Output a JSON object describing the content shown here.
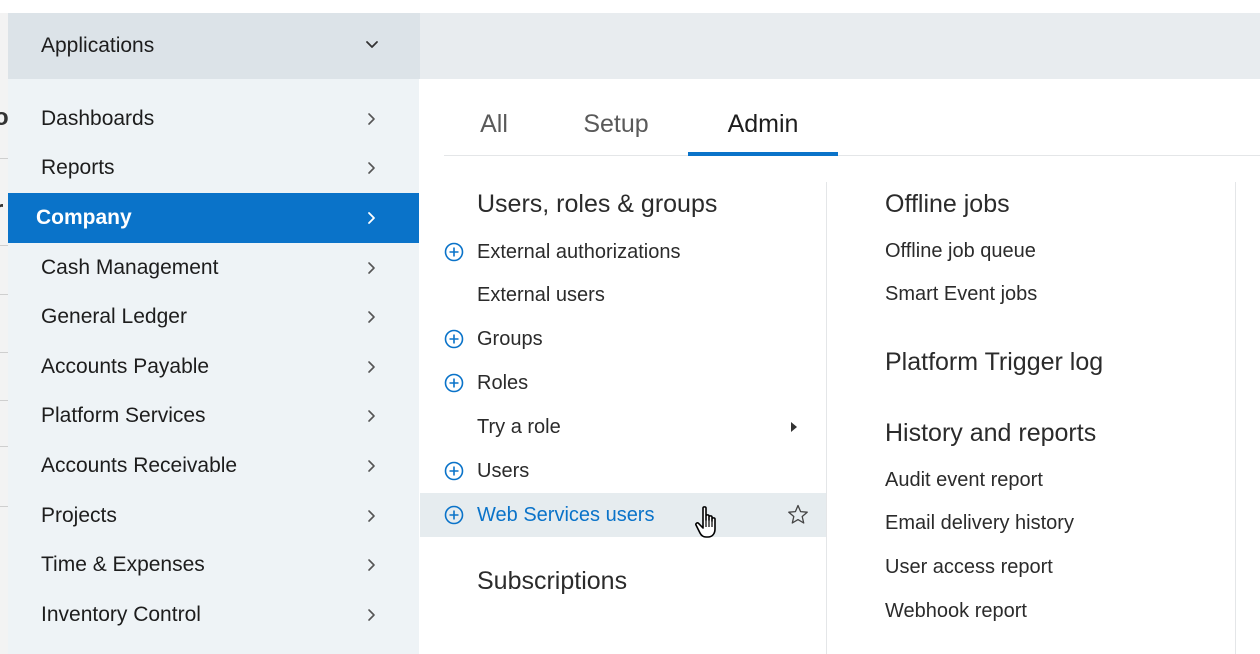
{
  "background_fragments": [
    "o",
    "r"
  ],
  "sidebar": {
    "header": {
      "label": "Applications",
      "icon": "chevron-down-icon"
    },
    "items": [
      {
        "label": "Dashboards",
        "active": false
      },
      {
        "label": "Reports",
        "active": false
      },
      {
        "label": "Company",
        "active": true
      },
      {
        "label": "Cash Management",
        "active": false
      },
      {
        "label": "General Ledger",
        "active": false
      },
      {
        "label": "Accounts Payable",
        "active": false
      },
      {
        "label": "Platform Services",
        "active": false
      },
      {
        "label": "Accounts Receivable",
        "active": false
      },
      {
        "label": "Projects",
        "active": false
      },
      {
        "label": "Time & Expenses",
        "active": false
      },
      {
        "label": "Inventory Control",
        "active": false
      }
    ]
  },
  "tabs": [
    {
      "label": "All",
      "active": false
    },
    {
      "label": "Setup",
      "active": false
    },
    {
      "label": "Admin",
      "active": true
    }
  ],
  "left_column": {
    "users_section": {
      "title": "Users, roles & groups",
      "links": [
        {
          "label": "External authorizations",
          "plus": true
        },
        {
          "label": "External users",
          "plus": false
        },
        {
          "label": "Groups",
          "plus": true
        },
        {
          "label": "Roles",
          "plus": true
        },
        {
          "label": "Try a role",
          "plus": false,
          "submenu": true
        },
        {
          "label": "Users",
          "plus": true
        },
        {
          "label": "Web Services users",
          "plus": true,
          "hover": true,
          "star": true
        }
      ]
    },
    "subscriptions_section": {
      "title": "Subscriptions"
    }
  },
  "right_column": {
    "offline_jobs": {
      "title": "Offline jobs",
      "links": [
        "Offline job queue",
        "Smart Event jobs"
      ]
    },
    "platform_trigger": {
      "title": "Platform Trigger log"
    },
    "history": {
      "title": "History and reports",
      "links": [
        "Audit event report",
        "Email delivery history",
        "User access report",
        "Webhook report"
      ]
    }
  },
  "colors": {
    "accent": "#0a73c9",
    "sidebar_bg": "#eef3f6",
    "header_bg": "#dce3e8",
    "hover_bg": "#e6ecef"
  }
}
